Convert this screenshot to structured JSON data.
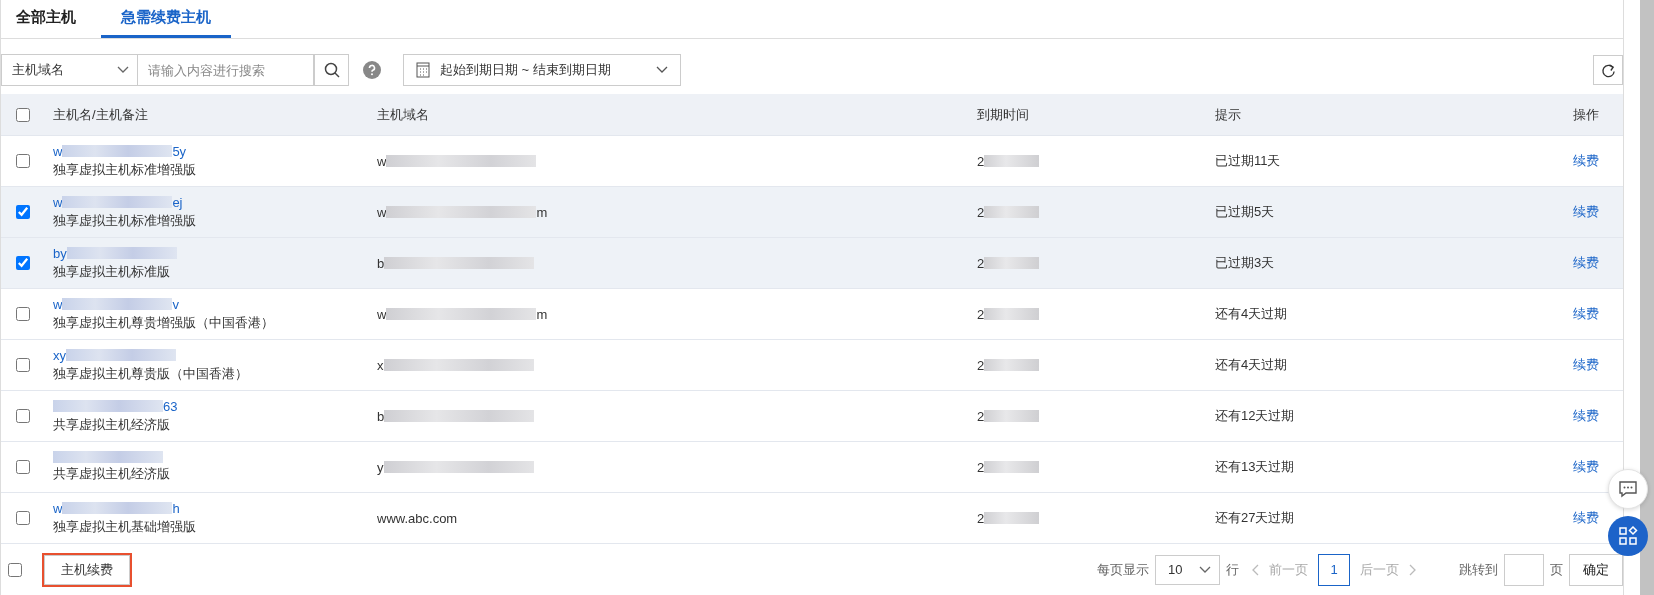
{
  "tabs": [
    {
      "label": "全部主机",
      "selected": false
    },
    {
      "label": "急需续费主机",
      "selected": true
    }
  ],
  "toolbar": {
    "field_select": "主机域名",
    "search": {
      "placeholder": "请输入内容进行搜索"
    },
    "date_range": "起始到期日期 ~ 结束到期日期"
  },
  "table": {
    "columns": [
      "主机名/主机备注",
      "主机域名",
      "到期时间",
      "提示",
      "操作"
    ],
    "all_checked": false,
    "rows": [
      {
        "checked": false,
        "name": {
          "prefix": "w",
          "suffix": "5y"
        },
        "plan": "独享虚拟主机标准增强版",
        "domain": {
          "prefix": "w"
        },
        "date": {
          "prefix": "2"
        },
        "tip": "已过期11天",
        "action": "续费"
      },
      {
        "checked": true,
        "name": {
          "prefix": "w",
          "suffix": "ej"
        },
        "plan": "独享虚拟主机标准增强版",
        "domain": {
          "prefix": "w",
          "suffix": "m"
        },
        "date": {
          "prefix": "2"
        },
        "tip": "已过期5天",
        "action": "续费"
      },
      {
        "checked": true,
        "name": {
          "prefix": "by"
        },
        "plan": "独享虚拟主机标准版",
        "domain": {
          "prefix": "b"
        },
        "date": {
          "prefix": "2"
        },
        "tip": "已过期3天",
        "action": "续费"
      },
      {
        "checked": false,
        "name": {
          "prefix": "w",
          "suffix": "v"
        },
        "plan": "独享虚拟主机尊贵增强版（中国香港）",
        "domain": {
          "prefix": "w",
          "suffix": "m"
        },
        "date": {
          "prefix": "2"
        },
        "tip": "还有4天过期",
        "action": "续费"
      },
      {
        "checked": false,
        "name": {
          "prefix": "xy"
        },
        "plan": "独享虚拟主机尊贵版（中国香港）",
        "domain": {
          "prefix": "x"
        },
        "date": {
          "prefix": "2"
        },
        "tip": "还有4天过期",
        "action": "续费"
      },
      {
        "checked": false,
        "name": {
          "suffix": "63"
        },
        "plan": "共享虚拟主机经济版",
        "domain": {
          "prefix": "b"
        },
        "date": {
          "prefix": "2"
        },
        "tip": "还有12天过期",
        "action": "续费"
      },
      {
        "checked": false,
        "name": {},
        "plan": "共享虚拟主机经济版",
        "domain": {
          "prefix": "y"
        },
        "date": {
          "prefix": "2"
        },
        "tip": "还有13天过期",
        "action": "续费"
      },
      {
        "checked": false,
        "name": {
          "prefix": "w",
          "suffix": "h"
        },
        "plan": "独享虚拟主机基础增强版",
        "domain": {
          "text": "www.abc.com"
        },
        "date": {
          "prefix": "2"
        },
        "tip": "还有27天过期",
        "action": "续费"
      }
    ]
  },
  "footer": {
    "checked": false,
    "renew_button": {
      "label": "主机续费",
      "highlighted": true
    },
    "pagination": {
      "per_page_label": "每页显示",
      "per_page": "10",
      "rows_label": "行",
      "prev": "前一页",
      "pages": [
        {
          "label": "1",
          "selected": true
        }
      ],
      "next": "后一页",
      "jump_label": "跳转到",
      "page_label": "页",
      "confirm": "确定"
    }
  }
}
